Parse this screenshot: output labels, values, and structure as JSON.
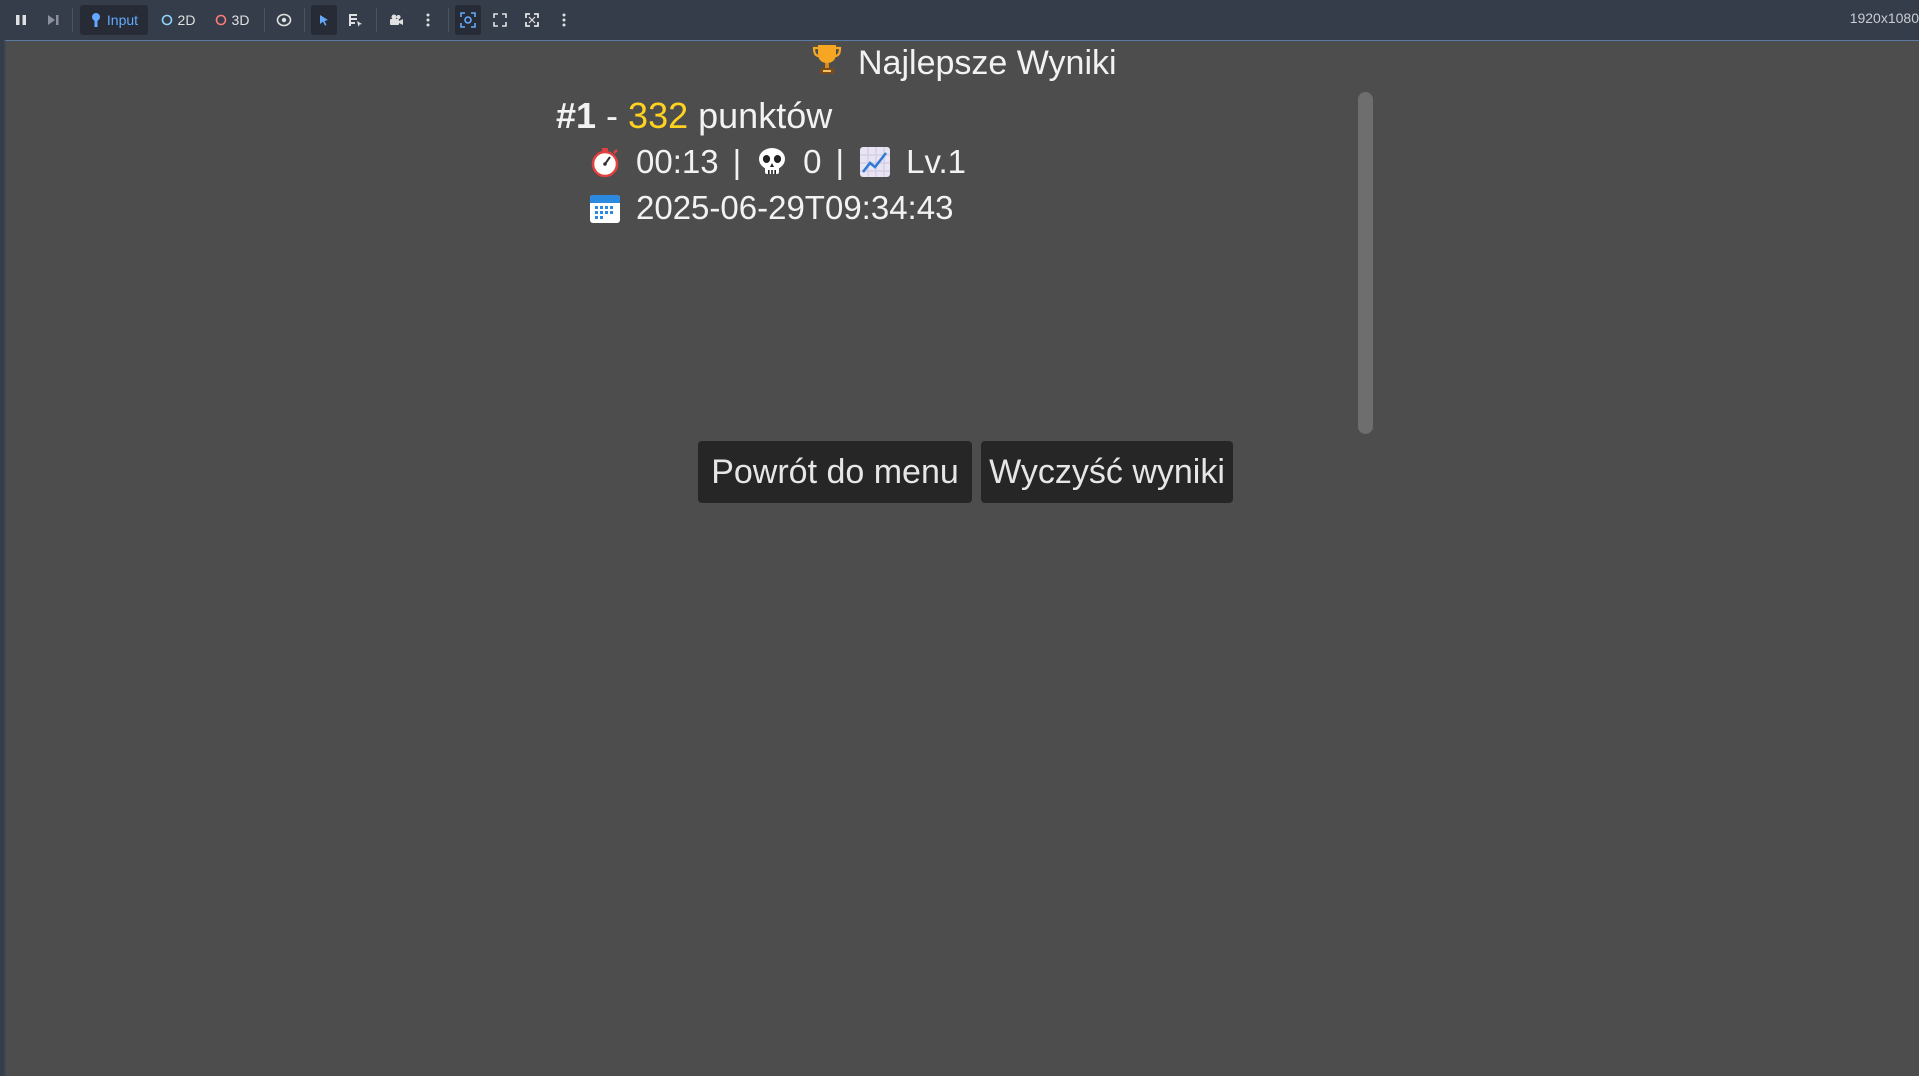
{
  "toolbar": {
    "pause_icon": "pause-icon",
    "step_icon": "next-frame-icon",
    "input_label": "Input",
    "mode_2d_label": "2D",
    "mode_3d_label": "3D",
    "resolution": "1920x1080"
  },
  "scene": {
    "title": "Najlepsze Wyniki",
    "title_icon": "trophy-icon"
  },
  "scores": [
    {
      "rank": "#1",
      "dash": "-",
      "points": "332",
      "points_label": "punktów",
      "time": "00:13",
      "deaths": "0",
      "level": "Lv.1",
      "separator": "|",
      "date": "2025-06-29T09:34:43"
    }
  ],
  "buttons": {
    "back": "Powrót do menu",
    "clear": "Wyczyść wyniki"
  },
  "colors": {
    "points": "#ffd21f",
    "background": "#4d4d4d",
    "toolbar": "#363d4a",
    "button": "#262626"
  }
}
